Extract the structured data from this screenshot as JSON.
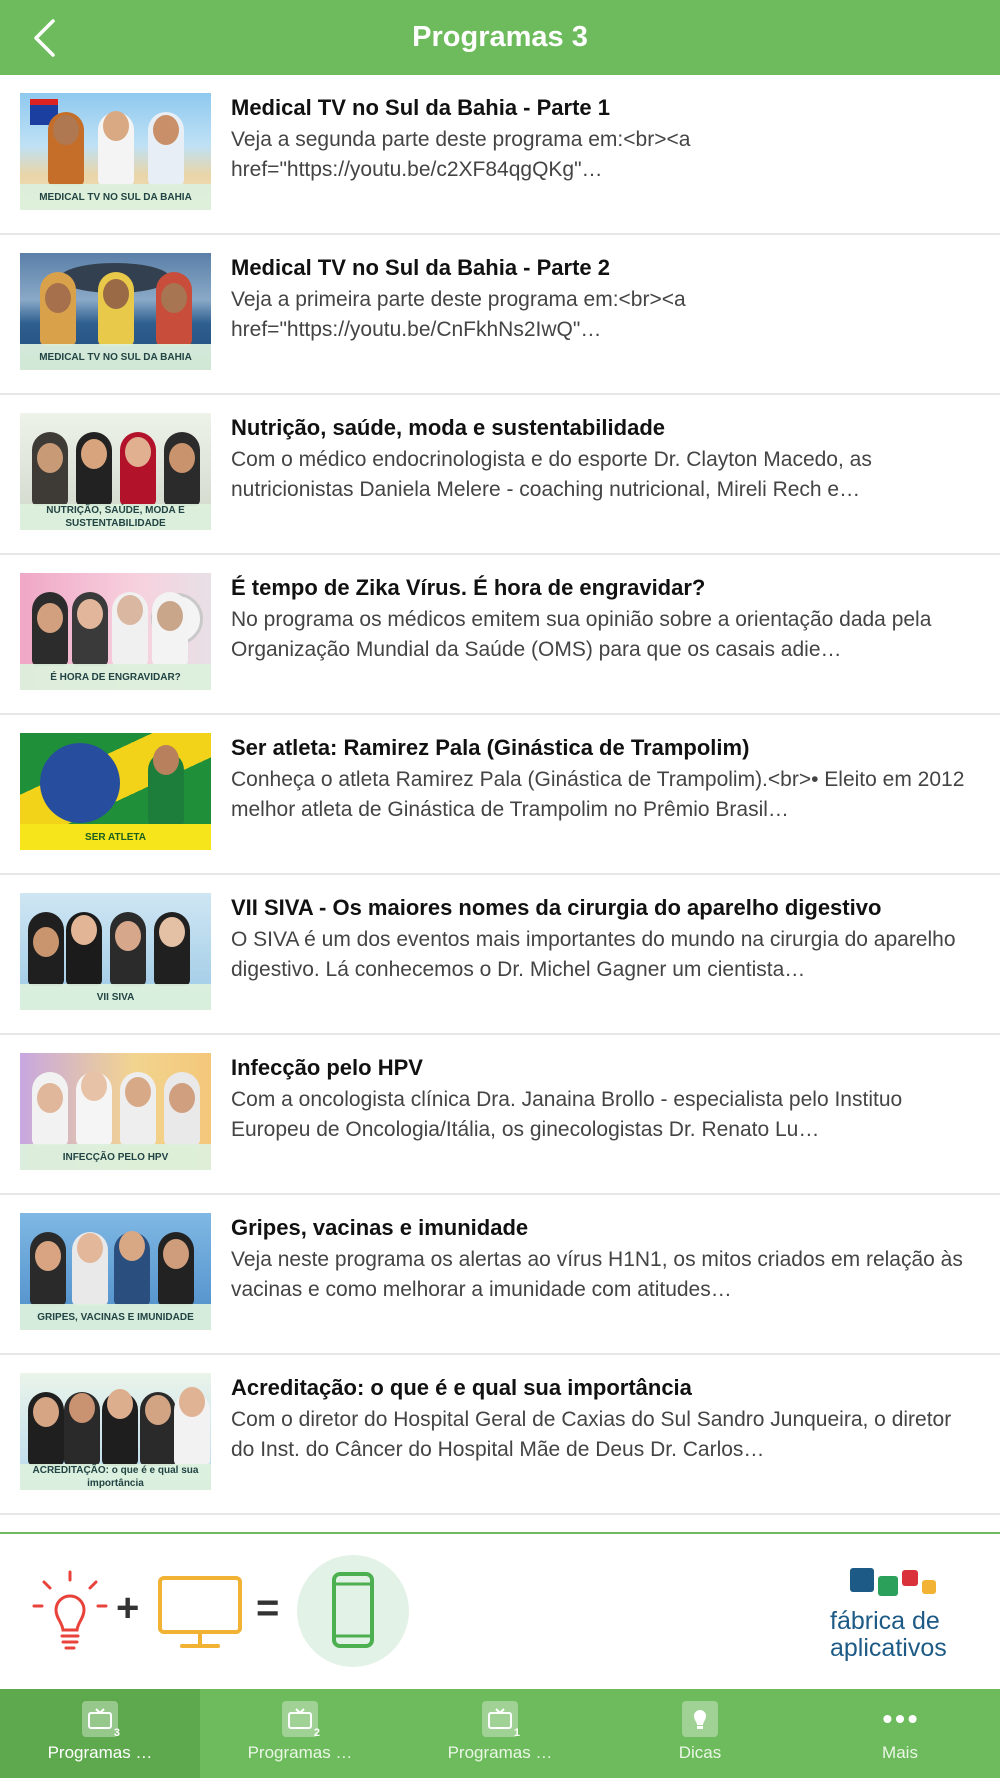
{
  "header": {
    "title": "Programas 3"
  },
  "items": [
    {
      "title": "Medical TV no Sul da Bahia - Parte 1",
      "desc": "Veja a segunda parte deste programa em:<br><a href=\"https://youtu.be/c2XF84qgQKg\"…",
      "thumb_caption": "MEDICAL TV NO SUL DA BAHIA"
    },
    {
      "title": "Medical TV no Sul da Bahia - Parte 2",
      "desc": "Veja a primeira parte deste programa em:<br><a href=\"https://youtu.be/CnFkhNs2IwQ\"…",
      "thumb_caption": "MEDICAL TV NO SUL DA BAHIA"
    },
    {
      "title": "Nutrição, saúde, moda e sustentabilidade",
      "desc": "Com o médico endocrinologista e do esporte Dr. Clayton Macedo, as nutricionistas Daniela Melere - coaching nutricional, Mireli Rech e…",
      "thumb_caption": "NUTRIÇÃO, SAÚDE, MODA E SUSTENTABILIDADE"
    },
    {
      "title": "É tempo de Zika Vírus. É hora de engravidar?",
      "desc": "No programa os médicos emitem sua opinião sobre a orientação dada pela Organização Mundial da Saúde (OMS) para que os casais adie…",
      "thumb_caption": "É HORA DE ENGRAVIDAR?"
    },
    {
      "title": "Ser atleta: Ramirez Pala (Ginástica de Trampolim)",
      "desc": "Conheça o atleta Ramirez Pala (Ginástica de Trampolim).<br>• Eleito em 2012 melhor atleta de Ginástica de Trampolim no Prêmio Brasil…",
      "thumb_caption": "SER ATLETA"
    },
    {
      "title": "VII SIVA - Os maiores nomes da cirurgia do aparelho digestivo",
      "desc": "O SIVA é um dos eventos mais importantes do mundo na cirurgia do aparelho digestivo. Lá conhecemos o Dr. Michel Gagner um cientista…",
      "thumb_caption": "VII SIVA"
    },
    {
      "title": "Infecção pelo HPV",
      "desc": "Com a oncologista clínica Dra. Janaina Brollo - especialista pelo Instituo Europeu de Oncologia/Itália, os ginecologistas Dr. Renato Lu…",
      "thumb_caption": "INFECÇÃO PELO HPV"
    },
    {
      "title": "Gripes, vacinas e imunidade",
      "desc": "Veja neste programa os alertas ao vírus H1N1, os mitos criados em relação às vacinas e como melhorar a imunidade com atitudes…",
      "thumb_caption": "GRIPES, VACINAS E IMUNIDADE"
    },
    {
      "title": "Acreditação: o que é e qual sua importância",
      "desc": "Com o diretor do Hospital Geral de Caxias do Sul Sandro Junqueira, o diretor do Inst. do Câncer do Hospital Mãe de Deus Dr. Carlos…",
      "thumb_caption": "ACREDITAÇÃO: o que é e qual sua importância"
    }
  ],
  "banner": {
    "plus": "+",
    "equals": "=",
    "brand_line1": "fábrica de",
    "brand_line2": "aplicativos"
  },
  "tabs": [
    {
      "label": "Programas …",
      "badge": "3",
      "icon": "tv-icon",
      "active": true
    },
    {
      "label": "Programas …",
      "badge": "2",
      "icon": "tv-icon",
      "active": false
    },
    {
      "label": "Programas …",
      "badge": "1",
      "icon": "tv-icon",
      "active": false
    },
    {
      "label": "Dicas",
      "badge": "",
      "icon": "lightbulb-icon",
      "active": false
    },
    {
      "label": "Mais",
      "badge": "",
      "icon": "more-icon",
      "active": false
    }
  ],
  "colors": {
    "accent": "#6dbb5c",
    "brand": "#1d5b86"
  }
}
